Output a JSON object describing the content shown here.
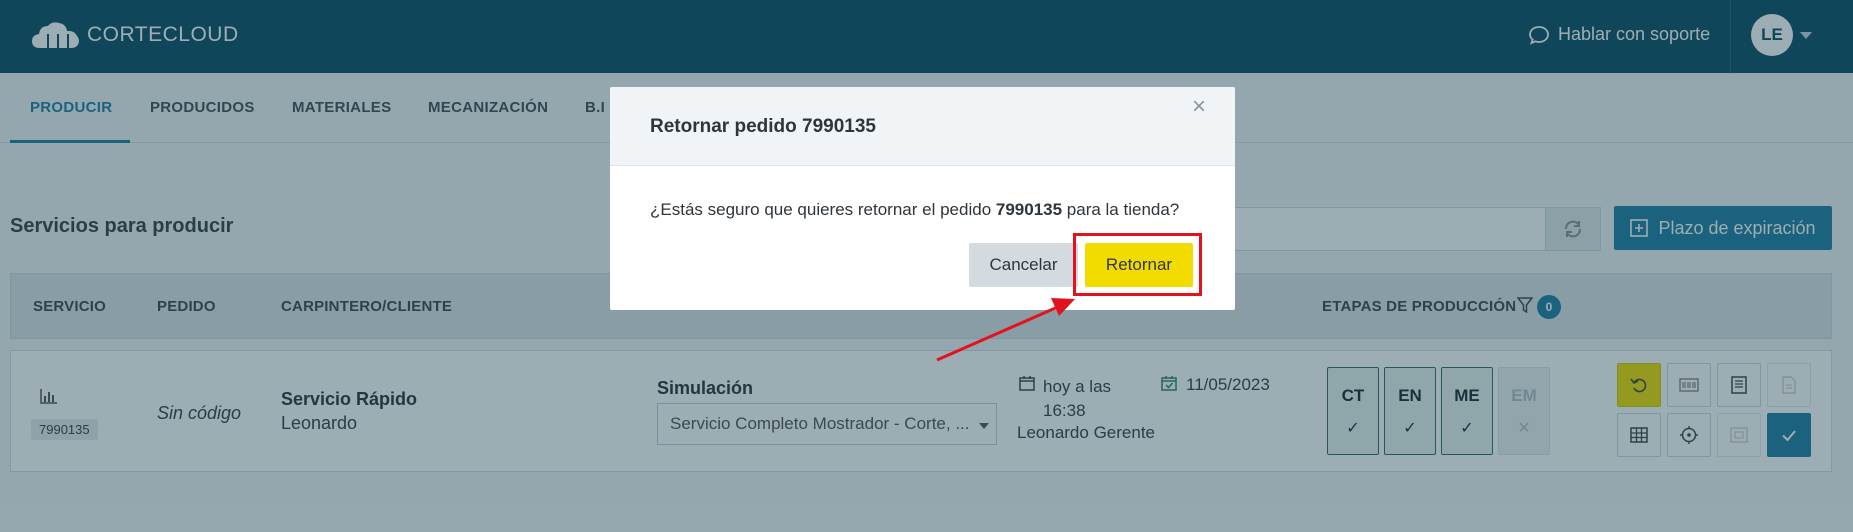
{
  "header": {
    "logo_text": "CORTECLOUD",
    "support_label": "Hablar con soporte",
    "avatar_initials": "LE"
  },
  "nav": {
    "tabs": [
      {
        "label": "PRODUCIR",
        "active": true
      },
      {
        "label": "PRODUCIDOS"
      },
      {
        "label": "MATERIALES"
      },
      {
        "label": "MECANIZACIÓN"
      },
      {
        "label": "B.I"
      }
    ]
  },
  "main": {
    "section_title": "Servicios para producir",
    "expire_button": "Plazo de expiración",
    "columns": {
      "servicio": "SERVICIO",
      "pedido": "PEDIDO",
      "cliente": "CARPINTERO/CLIENTE",
      "etapas": "ETAPAS DE PRODUCCIÓN",
      "filter_count": "0"
    },
    "row": {
      "order_code": "7990135",
      "pedido": "Sin código",
      "client_title": "Servicio Rápido",
      "client_name": "Leonardo",
      "sim_label": "Simulación",
      "sim_value": "Servicio Completo Mostrador - Corte, ...",
      "date_start": "hoy a las 16:38",
      "date_end": "11/05/2023",
      "user": "Leonardo Gerente",
      "stages": [
        {
          "label": "CT",
          "mark": "✓"
        },
        {
          "label": "EN",
          "mark": "✓"
        },
        {
          "label": "ME",
          "mark": "✓"
        },
        {
          "label": "EM",
          "mark": "✕"
        }
      ]
    }
  },
  "modal": {
    "title": "Retornar pedido 7990135",
    "close": "×",
    "msg_before": "¿Estás seguro que quieres retornar el pedido ",
    "msg_order": "7990135",
    "msg_after": " para la tienda?",
    "cancel_label": "Cancelar",
    "confirm_label": "Retornar"
  },
  "colors": {
    "header_bg": "#0f4f66",
    "accent": "#1f7fa3",
    "confirm": "#f2dc00",
    "highlight": "#e3131d"
  }
}
